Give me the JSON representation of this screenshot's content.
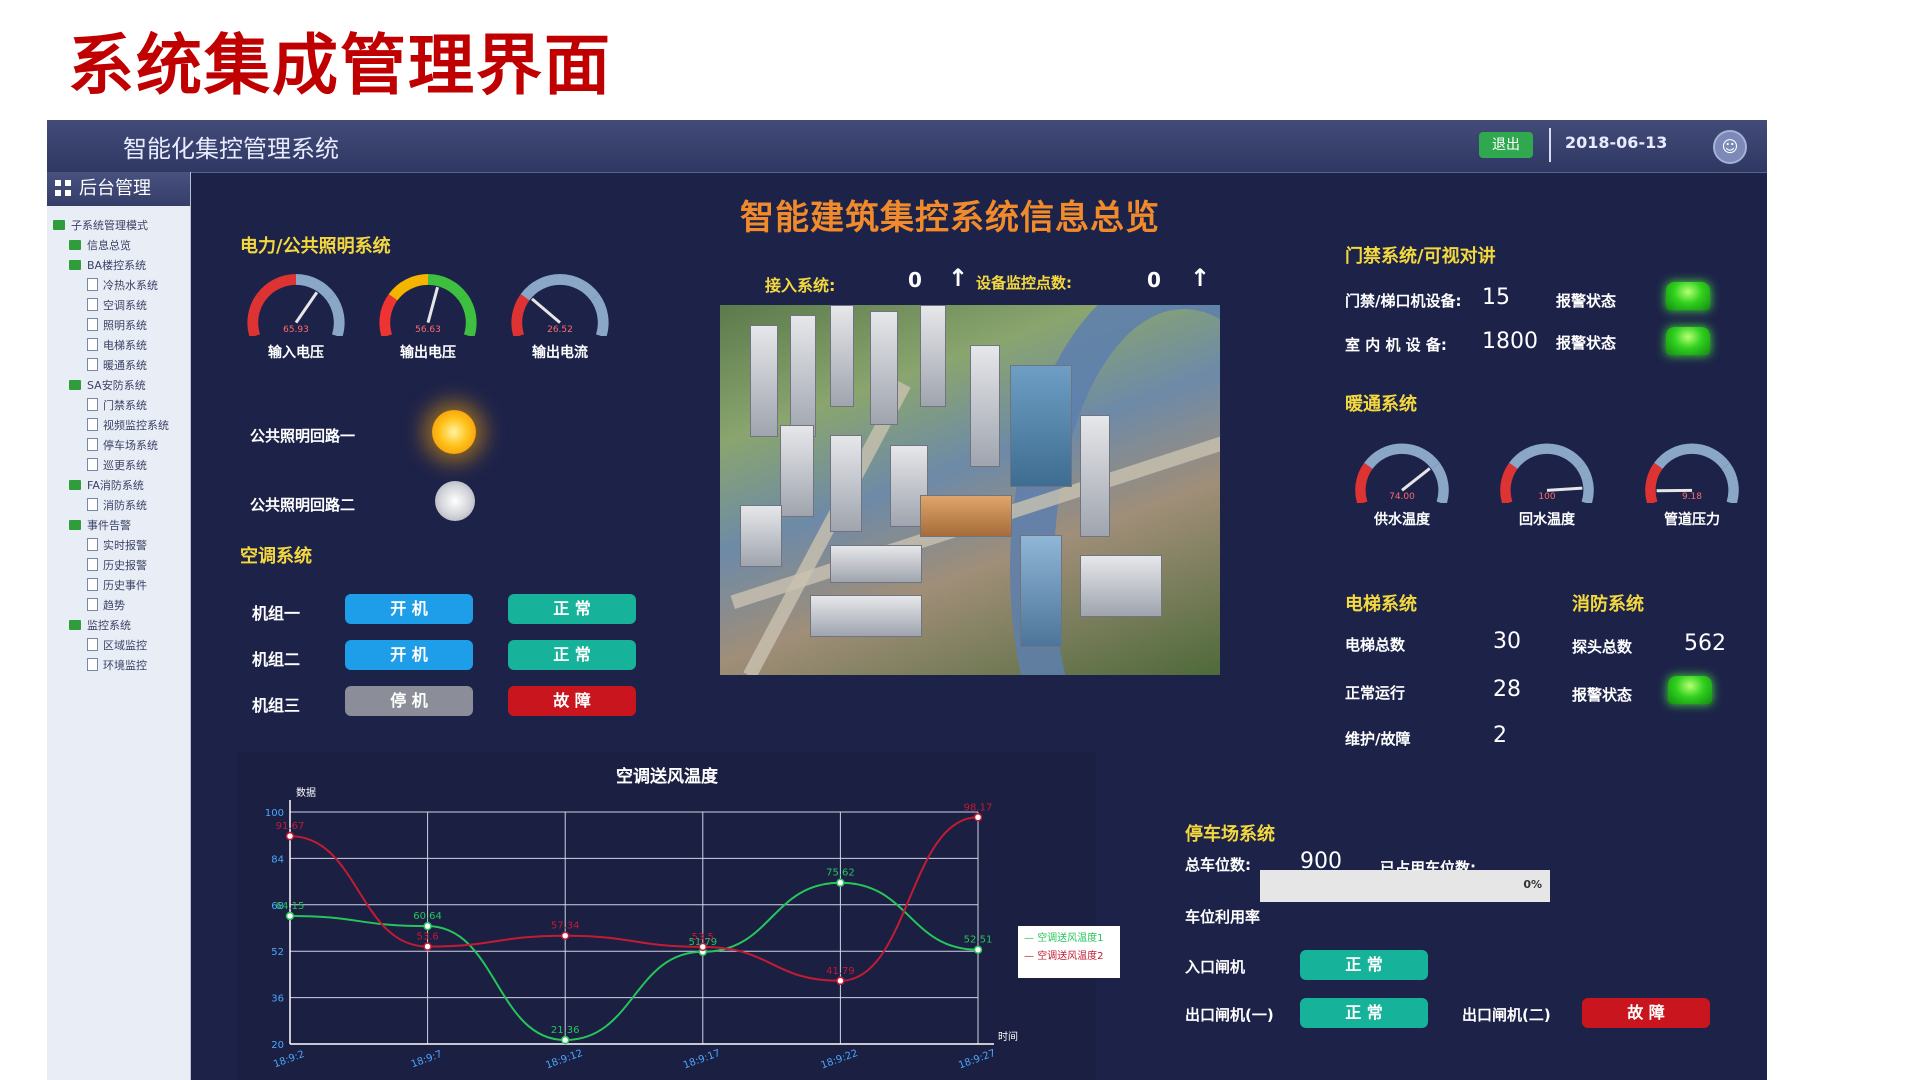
{
  "slide_title": "系统集成管理界面",
  "app": {
    "title": "智能化集控管理系统",
    "logout_label": "退出",
    "date": "2018-06-13",
    "user_icon": "user-icon"
  },
  "sidebar": {
    "header": "后台管理",
    "tree": [
      {
        "label": "子系统管理模式",
        "level": 0,
        "type": "folder"
      },
      {
        "label": "信息总览",
        "level": 1,
        "type": "folder"
      },
      {
        "label": "BA楼控系统",
        "level": 1,
        "type": "folder"
      },
      {
        "label": "冷热水系统",
        "level": 2,
        "type": "doc"
      },
      {
        "label": "空调系统",
        "level": 2,
        "type": "doc"
      },
      {
        "label": "照明系统",
        "level": 2,
        "type": "doc"
      },
      {
        "label": "电梯系统",
        "level": 2,
        "type": "doc"
      },
      {
        "label": "暖通系统",
        "level": 2,
        "type": "doc"
      },
      {
        "label": "SA安防系统",
        "level": 1,
        "type": "folder"
      },
      {
        "label": "门禁系统",
        "level": 2,
        "type": "doc"
      },
      {
        "label": "视频监控系统",
        "level": 2,
        "type": "doc"
      },
      {
        "label": "停车场系统",
        "level": 2,
        "type": "doc"
      },
      {
        "label": "巡更系统",
        "level": 2,
        "type": "doc"
      },
      {
        "label": "FA消防系统",
        "level": 1,
        "type": "folder"
      },
      {
        "label": "消防系统",
        "level": 2,
        "type": "doc"
      },
      {
        "label": "事件告警",
        "level": 1,
        "type": "folder"
      },
      {
        "label": "实时报警",
        "level": 2,
        "type": "doc"
      },
      {
        "label": "历史报警",
        "level": 2,
        "type": "doc"
      },
      {
        "label": "历史事件",
        "level": 2,
        "type": "doc"
      },
      {
        "label": "趋势",
        "level": 2,
        "type": "doc"
      },
      {
        "label": "监控系统",
        "level": 1,
        "type": "folder"
      },
      {
        "label": "区域监控",
        "level": 2,
        "type": "doc"
      },
      {
        "label": "环境监控",
        "level": 2,
        "type": "doc"
      }
    ]
  },
  "main": {
    "title": "智能建筑集控系统信息总览",
    "power": {
      "section": "电力/公共照明系统",
      "gauges": [
        {
          "label": "输入电压",
          "value": "65.93",
          "level": 0.66
        },
        {
          "label": "输出电压",
          "value": "56.63",
          "level": 0.57
        },
        {
          "label": "输出电流",
          "value": "26.52",
          "level": 0.27
        }
      ],
      "lighting": [
        {
          "label": "公共照明回路一",
          "state": "on"
        },
        {
          "label": "公共照明回路二",
          "state": "off"
        }
      ]
    },
    "ac": {
      "section": "空调系统",
      "units": [
        {
          "label": "机组一",
          "run": "开 机",
          "status": "正 常",
          "run_color": "#1e9ee8",
          "status_color": "#17b29a"
        },
        {
          "label": "机组二",
          "run": "开 机",
          "status": "正 常",
          "run_color": "#1e9ee8",
          "status_color": "#17b29a"
        },
        {
          "label": "机组三",
          "run": "停 机",
          "status": "故 障",
          "run_color": "#8b8e98",
          "status_color": "#c9151d"
        }
      ]
    },
    "access": {
      "label": "接入系统:",
      "value": "0",
      "monitor_label": "设备监控点数:",
      "monitor_value": "0"
    },
    "door": {
      "section": "门禁系统/可视对讲",
      "rows": [
        {
          "label": "门禁/梯口机设备:",
          "value": "15",
          "alarm_label": "报警状态"
        },
        {
          "label": "室 内 机 设 备:",
          "value": "1800",
          "alarm_label": "报警状态"
        }
      ]
    },
    "hvac": {
      "section": "暖通系统",
      "gauges": [
        {
          "label": "供水温度",
          "value": "74.00",
          "level": 0.74
        },
        {
          "label": "回水温度",
          "value": "100",
          "level": 0.9
        },
        {
          "label": "管道压力",
          "value": "9.18",
          "level": 0.08
        }
      ]
    },
    "elevator": {
      "section": "电梯系统",
      "rows": [
        {
          "label": "电梯总数",
          "value": "30"
        },
        {
          "label": "正常运行",
          "value": "28"
        },
        {
          "label": "维护/故障",
          "value": "2"
        }
      ]
    },
    "fire": {
      "section": "消防系统",
      "probe_label": "探头总数",
      "probe_value": "562",
      "alarm_label": "报警状态"
    },
    "parking": {
      "section": "停车场系统",
      "total_label": "总车位数:",
      "total_value": "900",
      "used_label": "已占用车位数:",
      "usage_label": "车位利用率",
      "usage_percent": "0%",
      "usage_fraction": 0,
      "entry_label": "入口闸机",
      "entry_status": "正 常",
      "exit1_label": "出口闸机(一)",
      "exit1_status": "正 常",
      "exit2_label": "出口闸机(二)",
      "exit2_status": "故 障"
    }
  },
  "chart_data": {
    "type": "line",
    "title": "空调送风温度",
    "ylabel": "数据",
    "xlabel": "时间",
    "x": [
      "18:9:2",
      "18:9:7",
      "18:9:12",
      "18:9:17",
      "18:9:22",
      "18:9:27"
    ],
    "yticks": [
      20,
      36,
      52,
      68,
      84,
      100
    ],
    "ylim": [
      20,
      100
    ],
    "series": [
      {
        "name": "空调送风温度1",
        "color": "#27c45a",
        "values": [
          64.15,
          60.64,
          21.36,
          51.79,
          75.62,
          52.51
        ]
      },
      {
        "name": "空调送风温度2",
        "color": "#c21b34",
        "values": [
          91.67,
          53.6,
          57.34,
          53.5,
          41.79,
          98.17
        ]
      }
    ],
    "legend": "right",
    "grid": true
  }
}
